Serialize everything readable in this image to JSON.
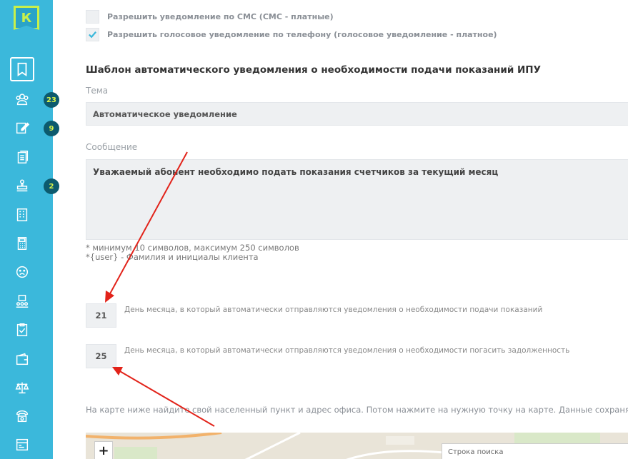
{
  "sidebar": {
    "logo": "К",
    "items": [
      {
        "icon": "flag-icon",
        "active": true
      },
      {
        "icon": "users-icon",
        "badge": "23"
      },
      {
        "icon": "edit-icon",
        "badge": "9"
      },
      {
        "icon": "documents-icon"
      },
      {
        "icon": "stamp-icon",
        "badge": "2"
      },
      {
        "icon": "building-icon"
      },
      {
        "icon": "calculator-icon"
      },
      {
        "icon": "sad-face-icon"
      },
      {
        "icon": "group-icon"
      },
      {
        "icon": "checklist-icon"
      },
      {
        "icon": "wallet-icon"
      },
      {
        "icon": "scales-icon"
      },
      {
        "icon": "phone-icon"
      },
      {
        "icon": "window-icon"
      }
    ],
    "colors": {
      "bg": "#3bb8db",
      "accent": "#c8f04a",
      "badge": "#0c5a6e"
    }
  },
  "notifications": {
    "sms_label": "Разрешить уведомление по СМС (СМС - платные)",
    "sms_checked": false,
    "voice_label": "Разрешить голосовое уведомление по телефону (голосовое уведомление - платное)",
    "voice_checked": true
  },
  "template": {
    "title": "Шаблон автоматического уведомления о необходимости подачи показаний ИПУ",
    "subject_label": "Тема",
    "subject_value": "Автоматическое уведомление",
    "message_label": "Сообщение",
    "message_value": "Уважаемый абонент необходимо подать показания счетчиков за текущий месяц",
    "hint_length": "* минимум 10 символов, максимум 250 символов",
    "hint_user": "*{user} - Фамилия и инициалы клиента"
  },
  "days": {
    "readings_day": "21",
    "readings_label": "День месяца, в который автоматически отправляются уведомления о необходимости подачи показаний",
    "debt_day": "25",
    "debt_label": "День месяца, в который автоматически отправляются уведомления о необходимости погасить задолженность"
  },
  "map": {
    "note": "На карте ниже найдите свой населенный пункт и адрес офиса. Потом нажмите на нужную точку на карте. Данные сохраня",
    "zoom_in": "+",
    "search_placeholder": "Строка поиска"
  }
}
